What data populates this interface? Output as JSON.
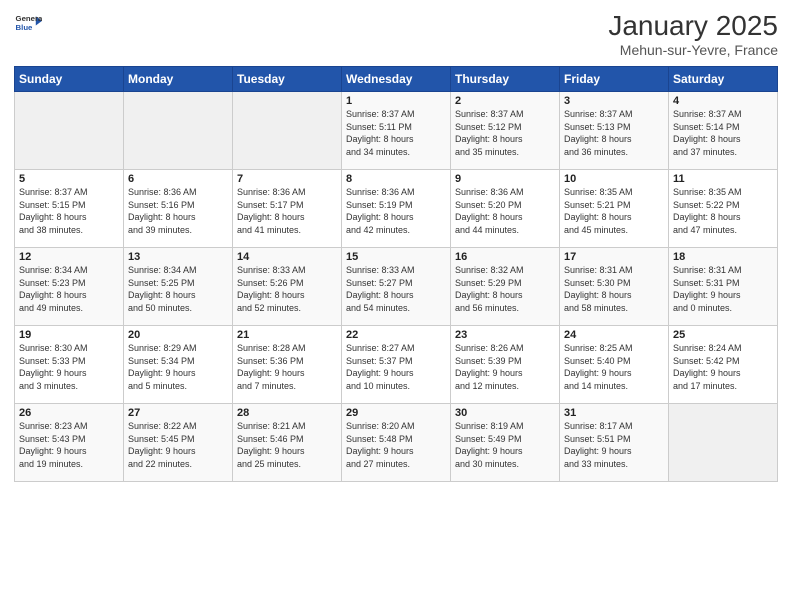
{
  "header": {
    "logo_general": "General",
    "logo_blue": "Blue",
    "month_title": "January 2025",
    "location": "Mehun-sur-Yevre, France"
  },
  "days_of_week": [
    "Sunday",
    "Monday",
    "Tuesday",
    "Wednesday",
    "Thursday",
    "Friday",
    "Saturday"
  ],
  "weeks": [
    [
      {
        "day": "",
        "info": ""
      },
      {
        "day": "",
        "info": ""
      },
      {
        "day": "",
        "info": ""
      },
      {
        "day": "1",
        "info": "Sunrise: 8:37 AM\nSunset: 5:11 PM\nDaylight: 8 hours\nand 34 minutes."
      },
      {
        "day": "2",
        "info": "Sunrise: 8:37 AM\nSunset: 5:12 PM\nDaylight: 8 hours\nand 35 minutes."
      },
      {
        "day": "3",
        "info": "Sunrise: 8:37 AM\nSunset: 5:13 PM\nDaylight: 8 hours\nand 36 minutes."
      },
      {
        "day": "4",
        "info": "Sunrise: 8:37 AM\nSunset: 5:14 PM\nDaylight: 8 hours\nand 37 minutes."
      }
    ],
    [
      {
        "day": "5",
        "info": "Sunrise: 8:37 AM\nSunset: 5:15 PM\nDaylight: 8 hours\nand 38 minutes."
      },
      {
        "day": "6",
        "info": "Sunrise: 8:36 AM\nSunset: 5:16 PM\nDaylight: 8 hours\nand 39 minutes."
      },
      {
        "day": "7",
        "info": "Sunrise: 8:36 AM\nSunset: 5:17 PM\nDaylight: 8 hours\nand 41 minutes."
      },
      {
        "day": "8",
        "info": "Sunrise: 8:36 AM\nSunset: 5:19 PM\nDaylight: 8 hours\nand 42 minutes."
      },
      {
        "day": "9",
        "info": "Sunrise: 8:36 AM\nSunset: 5:20 PM\nDaylight: 8 hours\nand 44 minutes."
      },
      {
        "day": "10",
        "info": "Sunrise: 8:35 AM\nSunset: 5:21 PM\nDaylight: 8 hours\nand 45 minutes."
      },
      {
        "day": "11",
        "info": "Sunrise: 8:35 AM\nSunset: 5:22 PM\nDaylight: 8 hours\nand 47 minutes."
      }
    ],
    [
      {
        "day": "12",
        "info": "Sunrise: 8:34 AM\nSunset: 5:23 PM\nDaylight: 8 hours\nand 49 minutes."
      },
      {
        "day": "13",
        "info": "Sunrise: 8:34 AM\nSunset: 5:25 PM\nDaylight: 8 hours\nand 50 minutes."
      },
      {
        "day": "14",
        "info": "Sunrise: 8:33 AM\nSunset: 5:26 PM\nDaylight: 8 hours\nand 52 minutes."
      },
      {
        "day": "15",
        "info": "Sunrise: 8:33 AM\nSunset: 5:27 PM\nDaylight: 8 hours\nand 54 minutes."
      },
      {
        "day": "16",
        "info": "Sunrise: 8:32 AM\nSunset: 5:29 PM\nDaylight: 8 hours\nand 56 minutes."
      },
      {
        "day": "17",
        "info": "Sunrise: 8:31 AM\nSunset: 5:30 PM\nDaylight: 8 hours\nand 58 minutes."
      },
      {
        "day": "18",
        "info": "Sunrise: 8:31 AM\nSunset: 5:31 PM\nDaylight: 9 hours\nand 0 minutes."
      }
    ],
    [
      {
        "day": "19",
        "info": "Sunrise: 8:30 AM\nSunset: 5:33 PM\nDaylight: 9 hours\nand 3 minutes."
      },
      {
        "day": "20",
        "info": "Sunrise: 8:29 AM\nSunset: 5:34 PM\nDaylight: 9 hours\nand 5 minutes."
      },
      {
        "day": "21",
        "info": "Sunrise: 8:28 AM\nSunset: 5:36 PM\nDaylight: 9 hours\nand 7 minutes."
      },
      {
        "day": "22",
        "info": "Sunrise: 8:27 AM\nSunset: 5:37 PM\nDaylight: 9 hours\nand 10 minutes."
      },
      {
        "day": "23",
        "info": "Sunrise: 8:26 AM\nSunset: 5:39 PM\nDaylight: 9 hours\nand 12 minutes."
      },
      {
        "day": "24",
        "info": "Sunrise: 8:25 AM\nSunset: 5:40 PM\nDaylight: 9 hours\nand 14 minutes."
      },
      {
        "day": "25",
        "info": "Sunrise: 8:24 AM\nSunset: 5:42 PM\nDaylight: 9 hours\nand 17 minutes."
      }
    ],
    [
      {
        "day": "26",
        "info": "Sunrise: 8:23 AM\nSunset: 5:43 PM\nDaylight: 9 hours\nand 19 minutes."
      },
      {
        "day": "27",
        "info": "Sunrise: 8:22 AM\nSunset: 5:45 PM\nDaylight: 9 hours\nand 22 minutes."
      },
      {
        "day": "28",
        "info": "Sunrise: 8:21 AM\nSunset: 5:46 PM\nDaylight: 9 hours\nand 25 minutes."
      },
      {
        "day": "29",
        "info": "Sunrise: 8:20 AM\nSunset: 5:48 PM\nDaylight: 9 hours\nand 27 minutes."
      },
      {
        "day": "30",
        "info": "Sunrise: 8:19 AM\nSunset: 5:49 PM\nDaylight: 9 hours\nand 30 minutes."
      },
      {
        "day": "31",
        "info": "Sunrise: 8:17 AM\nSunset: 5:51 PM\nDaylight: 9 hours\nand 33 minutes."
      },
      {
        "day": "",
        "info": ""
      }
    ]
  ]
}
